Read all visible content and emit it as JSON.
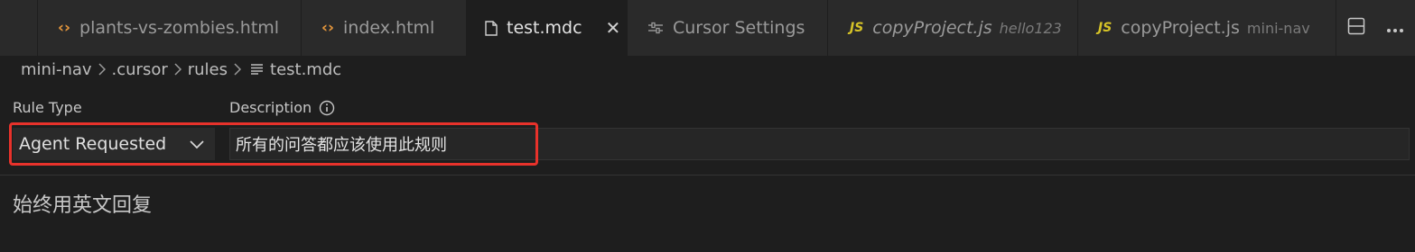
{
  "tabs": [
    {
      "icon": "code-icon",
      "label": "plants-vs-zombies.html",
      "desc": ""
    },
    {
      "icon": "code-icon",
      "label": "index.html",
      "desc": ""
    },
    {
      "icon": "file-icon",
      "label": "test.mdc",
      "desc": "",
      "active": true
    },
    {
      "icon": "settings-icon",
      "label": "Cursor Settings",
      "desc": ""
    },
    {
      "icon": "js-icon",
      "label": "copyProject.js",
      "desc": "hello123"
    },
    {
      "icon": "js-icon",
      "label": "copyProject.js",
      "desc": "mini-nav"
    }
  ],
  "js_badge": "JS",
  "tab_actions": [
    "split-editor-icon",
    "more-actions-icon"
  ],
  "breadcrumb": [
    "mini-nav",
    ".cursor",
    "rules",
    "test.mdc"
  ],
  "form": {
    "rule_type_label": "Rule Type",
    "rule_type_value": "Agent Requested",
    "description_label": "Description",
    "description_value": "所有的问答都应该使用此规则"
  },
  "body_text": "始终用英文回复",
  "colors": {
    "accent_js": "#d6c327",
    "accent_html": "#e4963c",
    "highlight": "#e8322b"
  }
}
